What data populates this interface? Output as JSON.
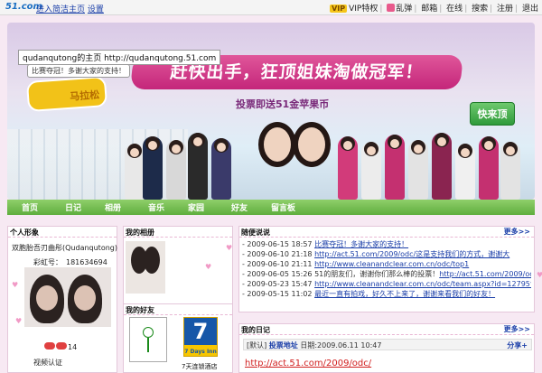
{
  "topbar": {
    "logo": "51.com",
    "links": [
      "进入简洁主页",
      "设置"
    ],
    "right": [
      "VIP",
      "VIP特权",
      "乱弹",
      "邮箱",
      "在线",
      "搜索",
      "注册",
      "退出"
    ]
  },
  "banner": {
    "url_line": "qudanqutong的主页 http://qudanqutong.51.com",
    "bubble": "比赛夺冠！多谢大家的支持！",
    "race_logo_text": "马拉松",
    "headline": "赶快出手，狂顶姐妹淘做冠军！",
    "subhead": "投票即送51金苹果币",
    "ding_button": "快来顶"
  },
  "nav": [
    "首页",
    "日记",
    "相册",
    "音乐",
    "家园",
    "好友",
    "留言板"
  ],
  "profile": {
    "header": "个人形象",
    "name": "双胞胎吾刃曲彤(Qudanqutong)",
    "caicai_label": "彩虹号：",
    "caicai_value": "181634694",
    "level_text": "14",
    "verify": "视频认证"
  },
  "album": {
    "header": "我的相册"
  },
  "friends": {
    "header": "我的好友",
    "sevendays": "7",
    "sevendays_sub": "7 Days Inn",
    "sevendays_label": "7天连锁酒店"
  },
  "talk": {
    "header": "随便说说",
    "more": "更多>>",
    "items": [
      {
        "date": "- 2009-06-15 18:57",
        "text": "比赛夺冠！多谢大家的支持！",
        "link": ""
      },
      {
        "date": "- 2009-06-10 21:18",
        "text": "",
        "link": "http://act.51.com/2009/odc/这是支持我们的方式，谢谢大"
      },
      {
        "date": "- 2009-06-10 21:11",
        "text": "",
        "link": "http://www.cleanandclear.com.cn/odc/top1"
      },
      {
        "date": "- 2009-06-05 15:26",
        "text": "51的朋友们，谢谢你们那么棒的投票！",
        "link": "http://act.51.com/2009/odc/ 希望大家可以"
      },
      {
        "date": "- 2009-05-23 15:47",
        "text": "",
        "link": "http://www.cleanandclear.com.cn/odc/team.aspx?id=12795记得参加了"
      },
      {
        "date": "- 2009-05-15 11:02",
        "text": "最近一直有拍戏，好久不上来了，谢谢来看我们的好友！",
        "link": ""
      }
    ]
  },
  "diary": {
    "header": "我的日记",
    "more": "更多>>",
    "tag": "[默认]",
    "title": "投票地址",
    "date": "日期:2009.06.11 10:47",
    "share": "分享+",
    "link": "http://act.51.com/2009/odc/"
  },
  "colors": {
    "accent_pink": "#e0569a",
    "nav_green": "#5fae3e",
    "link_blue": "#1a3ea8"
  }
}
